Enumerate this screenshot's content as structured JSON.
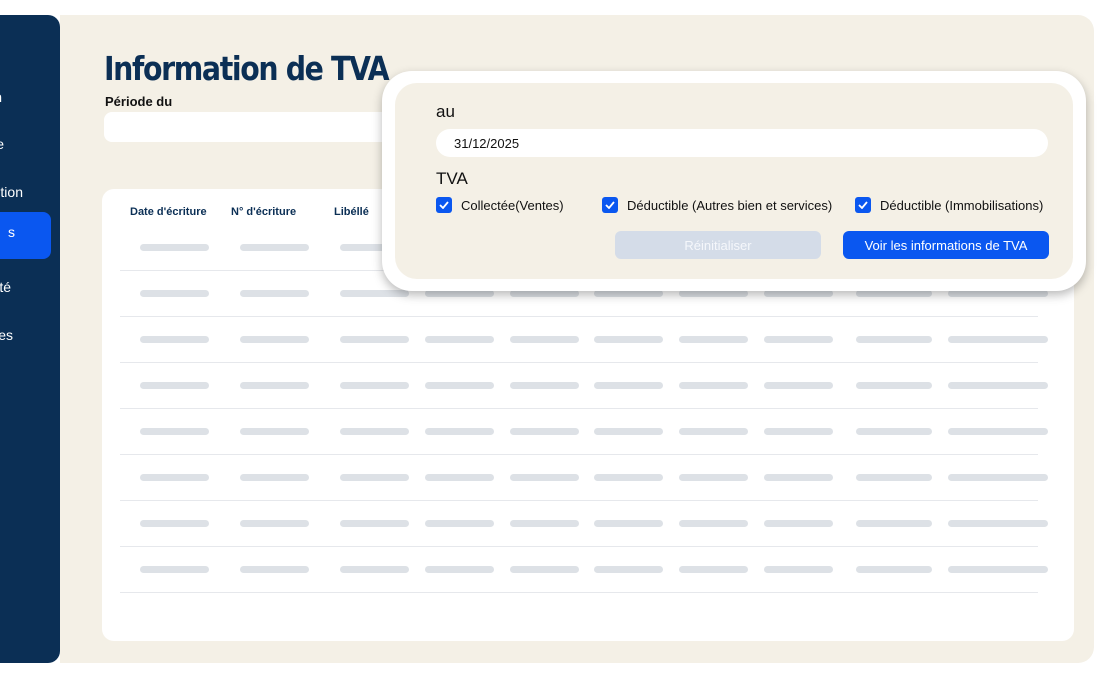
{
  "sidebar": {
    "items": [
      {
        "label": "n"
      },
      {
        "label": "e"
      },
      {
        "label": "tion"
      },
      {
        "label": "s",
        "active": true
      },
      {
        "label": "té"
      },
      {
        "label": "es"
      }
    ]
  },
  "page": {
    "title": "Information de TVA",
    "period_label": "Période du",
    "period_value": ""
  },
  "table": {
    "headers": [
      "Date d'écriture",
      "N° d'écriture",
      "Libéllé"
    ],
    "row_count": 8
  },
  "filter": {
    "au_label": "au",
    "date_value": "31/12/2025",
    "tva_label": "TVA",
    "checkboxes": [
      {
        "label": "Collectée(Ventes)",
        "checked": true
      },
      {
        "label": "Déductible (Autres bien et services)",
        "checked": true
      },
      {
        "label": "Déductible (Immobilisations)",
        "checked": true
      }
    ],
    "reset_label": "Réinitialiser",
    "submit_label": "Voir les informations de TVA"
  },
  "colors": {
    "sidebar": "#0b2f55",
    "accent": "#0a57f0",
    "panel": "#f4f0e6",
    "skeleton": "#dde1e6"
  },
  "icons": {
    "checkbox": "check-icon"
  }
}
